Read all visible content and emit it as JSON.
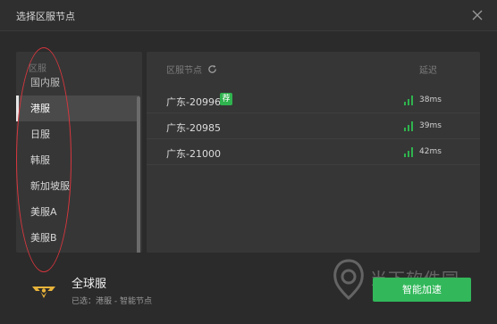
{
  "window": {
    "title": "选择区服节点"
  },
  "sidebar": {
    "header": "区服",
    "partial_item": "国内服",
    "items": [
      {
        "label": "港服"
      },
      {
        "label": "日服"
      },
      {
        "label": "韩服"
      },
      {
        "label": "新加坡服"
      },
      {
        "label": "美服A"
      },
      {
        "label": "美服B"
      }
    ],
    "active_index": 0
  },
  "main": {
    "node_header": "区服节点",
    "latency_header": "延迟",
    "nodes": [
      {
        "name": "广东-20996",
        "badge": "荐",
        "latency": "38ms"
      },
      {
        "name": "广东-20985",
        "badge": "",
        "latency": "39ms"
      },
      {
        "name": "广东-21000",
        "badge": "",
        "latency": "42ms"
      }
    ]
  },
  "footer": {
    "region_title": "全球服",
    "selected": "已选：港服 - 智能节点",
    "boost_button": "智能加速"
  },
  "watermark": {
    "text": "当下软件园"
  },
  "colors": {
    "accent_green": "#32b85a",
    "signal_green": "#2fb34e",
    "annotation_red": "#d9363e",
    "background": "#2b2b2b",
    "panel": "#363636"
  }
}
